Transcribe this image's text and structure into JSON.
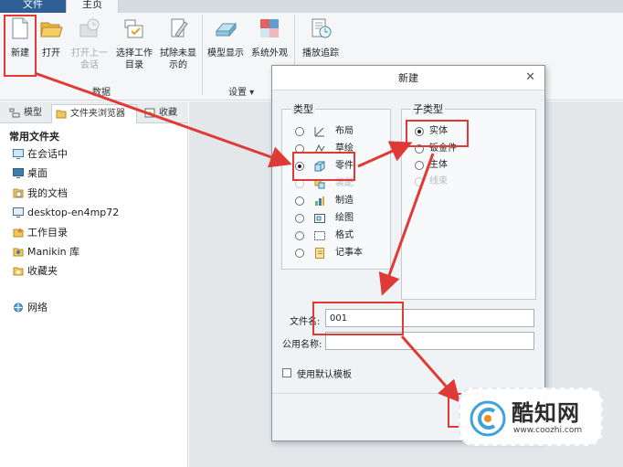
{
  "tabs": {
    "file": "文件",
    "home": "主页"
  },
  "ribbon": {
    "new": "新建",
    "open": "打开",
    "open_last_line1": "打开上一",
    "open_last_line2": "会话",
    "select_wd_line1": "选择工作",
    "select_wd_line2": "目录",
    "erase_line1": "拭除未显",
    "erase_line2": "示的",
    "model_display": "模型显示",
    "system_appearance": "系统外观",
    "playback_trail": "播放追踪",
    "group_data": "数据",
    "group_settings": "设置 ▾"
  },
  "panel": {
    "tab_model": "模型",
    "tab_browser": "文件夹浏览器",
    "tab_favorites": "收藏",
    "common_folders": "常用文件夹",
    "items": [
      "在会话中",
      "桌面",
      "我的文档",
      "desktop-en4mp72",
      "工作目录",
      "Manikin 库",
      "收藏夹"
    ],
    "network": "网络"
  },
  "dialog": {
    "title": "新建",
    "close": "✕",
    "type_title": "类型",
    "types": [
      "布局",
      "草绘",
      "零件",
      "装配",
      "制造",
      "绘图",
      "格式",
      "记事本"
    ],
    "selected_type": "零件",
    "subtype_title": "子类型",
    "subtypes": [
      "实体",
      "钣金件",
      "主体",
      "线束"
    ],
    "selected_subtype": "实体",
    "file_name_label": "文件名:",
    "file_name_value": "001",
    "common_name_label": "公用名称:",
    "common_name_value": "",
    "use_default_template": "使用默认模板"
  },
  "watermark": {
    "name": "酷知网",
    "url": "www.coozhi.com"
  },
  "colors": {
    "accent": "#2f5f96",
    "annotation": "#e03a36",
    "dialog_bg": "#f0f3f5"
  }
}
